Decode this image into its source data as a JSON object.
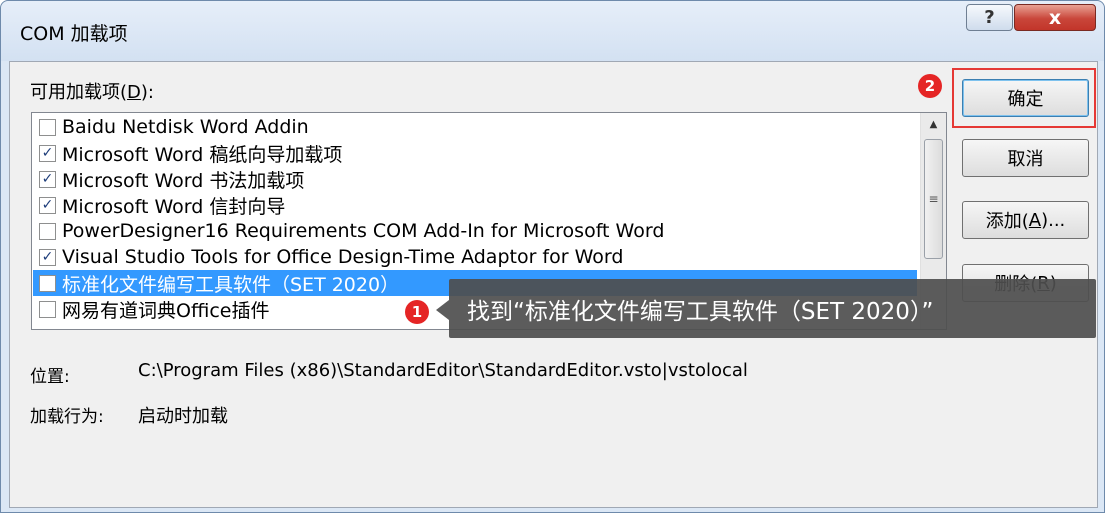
{
  "window": {
    "title": "COM 加载项",
    "help_glyph": "?",
    "close_glyph": "x"
  },
  "available": {
    "label_prefix": "可用加载项(",
    "label_key": "D",
    "label_suffix": "):"
  },
  "addins": [
    {
      "name": "Baidu Netdisk Word Addin",
      "checked": false,
      "selected": false
    },
    {
      "name": "Microsoft Word 稿纸向导加载项",
      "checked": true,
      "selected": false
    },
    {
      "name": "Microsoft Word 书法加载项",
      "checked": true,
      "selected": false
    },
    {
      "name": "Microsoft Word 信封向导",
      "checked": true,
      "selected": false
    },
    {
      "name": "PowerDesigner16 Requirements COM Add-In for Microsoft Word",
      "checked": false,
      "selected": false
    },
    {
      "name": "Visual Studio Tools for Office Design-Time Adaptor for Word",
      "checked": true,
      "selected": false
    },
    {
      "name": "标准化文件编写工具软件（SET 2020）",
      "checked": false,
      "selected": true
    },
    {
      "name": "网易有道词典Office插件",
      "checked": false,
      "selected": false
    }
  ],
  "buttons": {
    "ok": "确定",
    "cancel": "取消",
    "add_prefix": "添加(",
    "add_key": "A",
    "add_suffix": ")...",
    "remove_prefix": "删除(",
    "remove_key": "R",
    "remove_suffix": ")"
  },
  "details": {
    "location_label": "位置:",
    "location_value": "C:\\Program Files (x86)\\StandardEditor\\StandardEditor.vsto|vstolocal",
    "behavior_label": "加载行为:",
    "behavior_value": "启动时加载"
  },
  "annotations": {
    "step1_number": "1",
    "step1_text": "找到“标准化文件编写工具软件（SET 2020）”",
    "step2_number": "2"
  },
  "colors": {
    "selection": "#3399ff",
    "badge": "#e52525",
    "highlight_border": "#e53935"
  }
}
